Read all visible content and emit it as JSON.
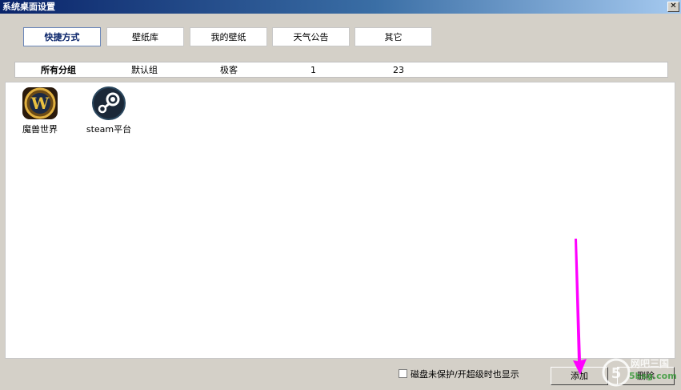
{
  "window": {
    "title": "系统桌面设置"
  },
  "tabs": [
    {
      "label": "快捷方式",
      "active": true
    },
    {
      "label": "壁纸库",
      "active": false
    },
    {
      "label": "我的壁纸",
      "active": false
    },
    {
      "label": "天气公告",
      "active": false
    },
    {
      "label": "其它",
      "active": false
    }
  ],
  "groups": [
    {
      "label": "所有分组",
      "active": true
    },
    {
      "label": "默认组",
      "active": false
    },
    {
      "label": "极客",
      "active": false
    },
    {
      "label": "1",
      "active": false
    },
    {
      "label": "23",
      "active": false
    }
  ],
  "shortcuts": [
    {
      "label": "魔兽世界",
      "icon": "warcraft-icon"
    },
    {
      "label": "steam平台",
      "icon": "steam-icon"
    }
  ],
  "footer": {
    "checkbox_label": "磁盘未保护/开超级时也显示",
    "checkbox_checked": false,
    "add_label": "添加",
    "delete_label": "删除"
  },
  "watermark": {
    "line1": "网吧三国",
    "line2": "5bsg.com"
  },
  "colors": {
    "titlebar": "#0a246a",
    "arrow": "#ff00ff",
    "face": "#d4d0c8"
  }
}
